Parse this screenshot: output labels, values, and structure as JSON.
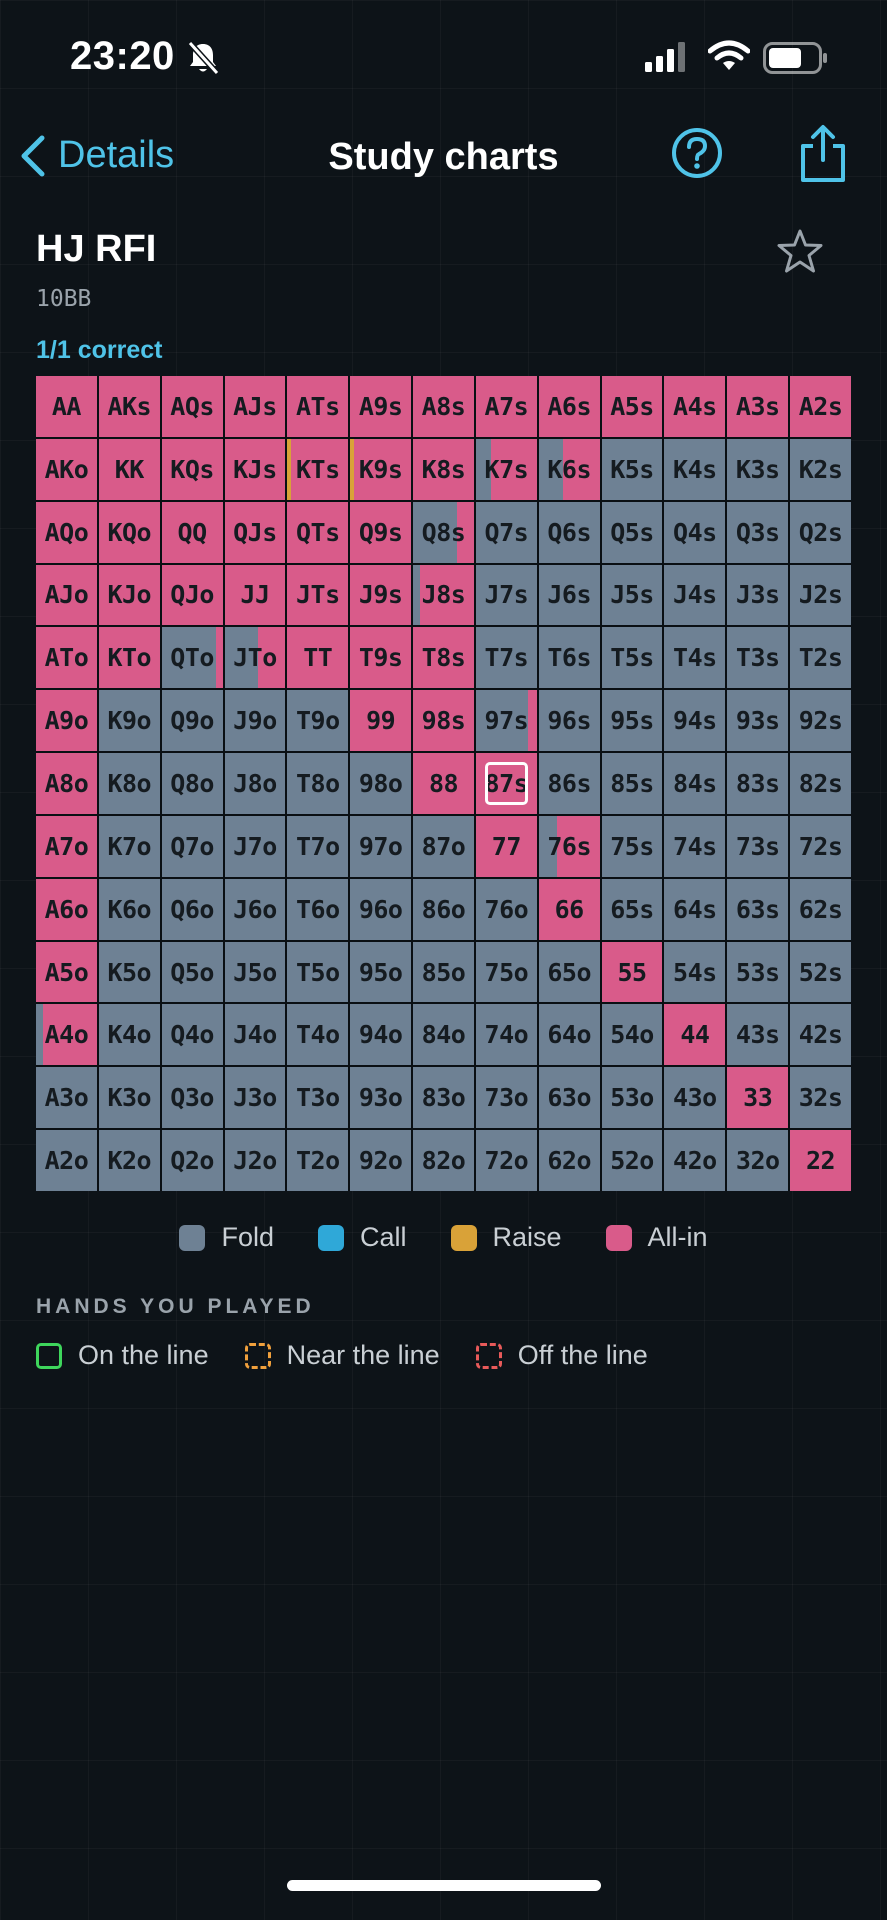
{
  "status": {
    "time": "23:20"
  },
  "nav": {
    "back_label": "Details",
    "title": "Study charts"
  },
  "chart": {
    "title": "HJ RFI",
    "stack": "10BB",
    "result": "1/1 correct"
  },
  "colors": {
    "fold": "#6e8194",
    "call": "#2fa8d8",
    "raise": "#d9a238",
    "allin": "#d95b8a"
  },
  "legend": [
    {
      "label": "Fold",
      "key": "fold"
    },
    {
      "label": "Call",
      "key": "call"
    },
    {
      "label": "Raise",
      "key": "raise"
    },
    {
      "label": "All-in",
      "key": "allin"
    }
  ],
  "hands_header": "HANDS YOU PLAYED",
  "hands_legend": [
    {
      "label": "On the line",
      "color": "#3ed65c",
      "style": "solid"
    },
    {
      "label": "Near the line",
      "color": "#f0a03c",
      "style": "dashed"
    },
    {
      "label": "Off the line",
      "color": "#e85a5a",
      "style": "dashed"
    }
  ],
  "hand_grid": [
    [
      "AA",
      "AKs",
      "AQs",
      "AJs",
      "ATs",
      "A9s",
      "A8s",
      "A7s",
      "A6s",
      "A5s",
      "A4s",
      "A3s",
      "A2s"
    ],
    [
      "AKo",
      "KK",
      "KQs",
      "KJs",
      "KTs",
      "K9s",
      "K8s",
      "K7s",
      "K6s",
      "K5s",
      "K4s",
      "K3s",
      "K2s"
    ],
    [
      "AQo",
      "KQo",
      "QQ",
      "QJs",
      "QTs",
      "Q9s",
      "Q8s",
      "Q7s",
      "Q6s",
      "Q5s",
      "Q4s",
      "Q3s",
      "Q2s"
    ],
    [
      "AJo",
      "KJo",
      "QJo",
      "JJ",
      "JTs",
      "J9s",
      "J8s",
      "J7s",
      "J6s",
      "J5s",
      "J4s",
      "J3s",
      "J2s"
    ],
    [
      "ATo",
      "KTo",
      "QTo",
      "JTo",
      "TT",
      "T9s",
      "T8s",
      "T7s",
      "T6s",
      "T5s",
      "T4s",
      "T3s",
      "T2s"
    ],
    [
      "A9o",
      "K9o",
      "Q9o",
      "J9o",
      "T9o",
      "99",
      "98s",
      "97s",
      "96s",
      "95s",
      "94s",
      "93s",
      "92s"
    ],
    [
      "A8o",
      "K8o",
      "Q8o",
      "J8o",
      "T8o",
      "98o",
      "88",
      "87s",
      "86s",
      "85s",
      "84s",
      "83s",
      "82s"
    ],
    [
      "A7o",
      "K7o",
      "Q7o",
      "J7o",
      "T7o",
      "97o",
      "87o",
      "77",
      "76s",
      "75s",
      "74s",
      "73s",
      "72s"
    ],
    [
      "A6o",
      "K6o",
      "Q6o",
      "J6o",
      "T6o",
      "96o",
      "86o",
      "76o",
      "66",
      "65s",
      "64s",
      "63s",
      "62s"
    ],
    [
      "A5o",
      "K5o",
      "Q5o",
      "J5o",
      "T5o",
      "95o",
      "85o",
      "75o",
      "65o",
      "55",
      "54s",
      "53s",
      "52s"
    ],
    [
      "A4o",
      "K4o",
      "Q4o",
      "J4o",
      "T4o",
      "94o",
      "84o",
      "74o",
      "64o",
      "54o",
      "44",
      "43s",
      "42s"
    ],
    [
      "A3o",
      "K3o",
      "Q3o",
      "J3o",
      "T3o",
      "93o",
      "83o",
      "73o",
      "63o",
      "53o",
      "43o",
      "33",
      "32s"
    ],
    [
      "A2o",
      "K2o",
      "Q2o",
      "J2o",
      "T2o",
      "92o",
      "82o",
      "72o",
      "62o",
      "52o",
      "42o",
      "32o",
      "22"
    ]
  ],
  "strategy": {
    "AA": {
      "allin": 1
    },
    "AKs": {
      "allin": 1
    },
    "AQs": {
      "allin": 1
    },
    "AJs": {
      "allin": 1
    },
    "ATs": {
      "allin": 1
    },
    "A9s": {
      "allin": 1
    },
    "A8s": {
      "allin": 1
    },
    "A7s": {
      "allin": 1
    },
    "A6s": {
      "allin": 1
    },
    "A5s": {
      "allin": 1
    },
    "A4s": {
      "allin": 1
    },
    "A3s": {
      "allin": 1
    },
    "A2s": {
      "allin": 1
    },
    "AKo": {
      "allin": 1
    },
    "KK": {
      "allin": 1
    },
    "KQs": {
      "allin": 1
    },
    "KJs": {
      "allin": 1
    },
    "KTs": {
      "raise": 0.06,
      "allin": 0.94
    },
    "K9s": {
      "raise": 0.06,
      "allin": 0.94
    },
    "K8s": {
      "allin": 1
    },
    "K7s": {
      "fold": 0.25,
      "allin": 0.75
    },
    "K6s": {
      "fold": 0.4,
      "allin": 0.6
    },
    "AQo": {
      "allin": 1
    },
    "KQo": {
      "allin": 1
    },
    "QQ": {
      "allin": 1
    },
    "QJs": {
      "allin": 1
    },
    "QTs": {
      "allin": 1
    },
    "Q9s": {
      "allin": 1
    },
    "Q8s": {
      "fold": 0.72,
      "allin": 0.28
    },
    "AJo": {
      "allin": 1
    },
    "KJo": {
      "allin": 1
    },
    "QJo": {
      "allin": 1
    },
    "JJ": {
      "allin": 1
    },
    "JTs": {
      "allin": 1
    },
    "J9s": {
      "allin": 1
    },
    "J8s": {
      "fold": 0.12,
      "allin": 0.88
    },
    "ATo": {
      "allin": 1
    },
    "KTo": {
      "allin": 1
    },
    "QTo": {
      "fold": 0.9,
      "allin": 0.1
    },
    "JTo": {
      "fold": 0.55,
      "allin": 0.45
    },
    "TT": {
      "allin": 1
    },
    "T9s": {
      "allin": 1
    },
    "T8s": {
      "allin": 1
    },
    "A9o": {
      "allin": 1
    },
    "99": {
      "allin": 1
    },
    "98s": {
      "allin": 1
    },
    "97s": {
      "fold": 0.85,
      "allin": 0.15
    },
    "A8o": {
      "allin": 1
    },
    "88": {
      "allin": 1
    },
    "87s": {
      "allin": 1
    },
    "A7o": {
      "allin": 1
    },
    "77": {
      "allin": 1
    },
    "76s": {
      "fold": 0.3,
      "allin": 0.7
    },
    "A6o": {
      "allin": 1
    },
    "66": {
      "allin": 1
    },
    "A5o": {
      "allin": 1
    },
    "55": {
      "allin": 1
    },
    "A4o": {
      "fold": 0.12,
      "allin": 0.88
    },
    "44": {
      "allin": 1
    },
    "33": {
      "allin": 1
    },
    "22": {
      "allin": 1
    }
  },
  "played_hand": "87s"
}
